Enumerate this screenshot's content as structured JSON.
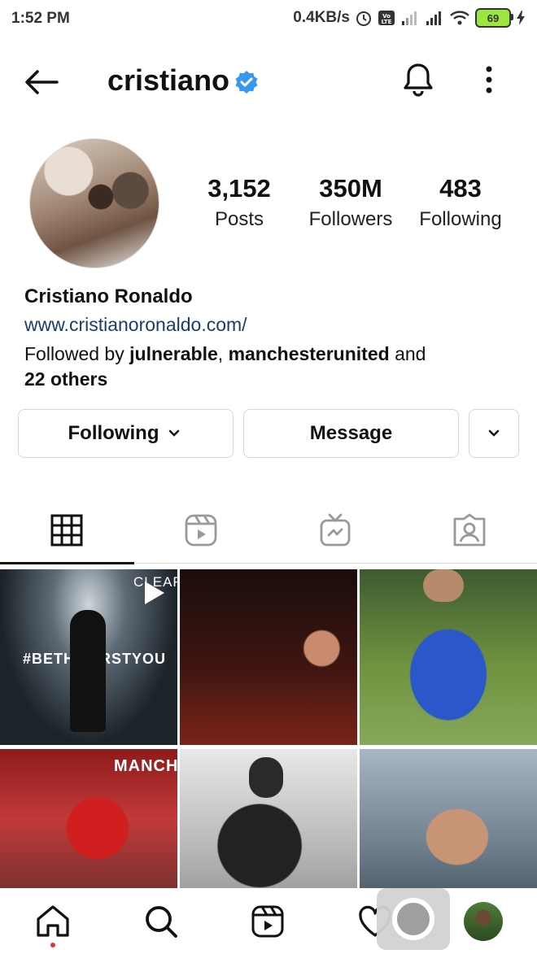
{
  "status_bar": {
    "time": "1:52 PM",
    "net_speed": "0.4KB/s",
    "battery": "69"
  },
  "header": {
    "username": "cristiano",
    "verified_icon": "verified-badge-icon",
    "back_icon": "back-arrow-icon",
    "bell_icon": "bell-icon",
    "more_icon": "more-vertical-icon"
  },
  "profile": {
    "stats": [
      {
        "value": "3,152",
        "label": "Posts"
      },
      {
        "value": "350M",
        "label": "Followers"
      },
      {
        "value": "483",
        "label": "Following"
      }
    ],
    "full_name": "Cristiano Ronaldo",
    "website": "www.cristianoronaldo.com/",
    "followed_by_prefix": "Followed by",
    "followed_by_user1": "julnerable",
    "followed_by_sep": ",",
    "followed_by_user2": "manchesterunited",
    "followed_by_and": "and",
    "followed_by_others": "22 others"
  },
  "actions": {
    "following_label": "Following",
    "message_label": "Message"
  },
  "tabs": [
    {
      "name": "grid",
      "icon": "grid-icon",
      "active": true
    },
    {
      "name": "reels",
      "icon": "reels-icon",
      "active": false
    },
    {
      "name": "igtv",
      "icon": "igtv-icon",
      "active": false
    },
    {
      "name": "tagged",
      "icon": "tagged-user-icon",
      "active": false
    }
  ],
  "posts": {
    "post1_brand": "CLEAR",
    "post1_hashtag": "#BETHEFIRSTYOU",
    "post4_banner": "MANCH"
  },
  "bottom_nav": [
    {
      "name": "home",
      "icon": "home-icon",
      "active": true
    },
    {
      "name": "search",
      "icon": "search-icon"
    },
    {
      "name": "reels",
      "icon": "reels-icon"
    },
    {
      "name": "activity",
      "icon": "heart-icon"
    },
    {
      "name": "profile",
      "icon": "profile-avatar"
    }
  ],
  "colors": {
    "link": "#1a3d6b",
    "verified": "#3897f0",
    "active_dot": "#e0352b",
    "battery_fill": "#9be63f"
  }
}
